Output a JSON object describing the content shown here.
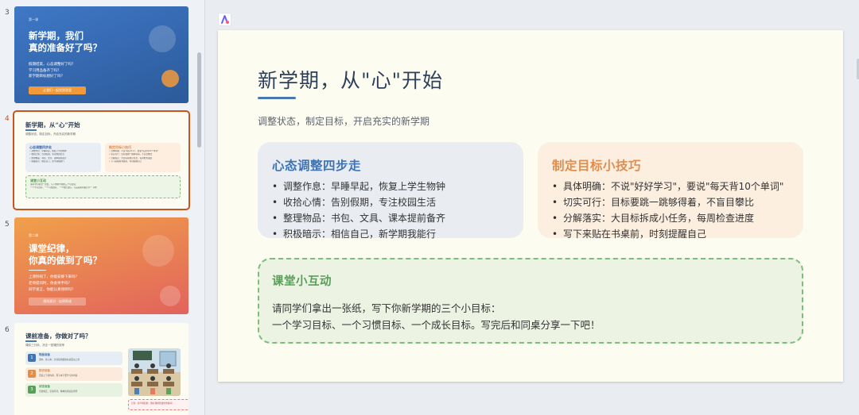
{
  "thumbnails": [
    {
      "number": "3",
      "tag": "第一课",
      "title_lines": [
        "新学期，我们",
        "真的准备好了吗？"
      ],
      "subtitle_lines": [
        "假期结束，心态调整好了吗？",
        "学习用品备齐了吗？",
        "新学期目标想好了吗？"
      ],
      "button": "让我们一起找到答案"
    },
    {
      "number": "4",
      "title": "新学期，从“心”开始",
      "subtitle": "调整状态，制定目标，开启充实的新学期",
      "box1_title": "心态调整四步走",
      "box1_lines": [
        "• 调整作息：早睡早起，恢复上学生物钟",
        "• 收拾心情：告别假期，专注校园生活",
        "• 整理物品：书包、文具、课本提前备齐",
        "• 积极暗示：相信自己，新学期我能行"
      ],
      "box2_title": "制定目标小技巧",
      "box2_lines": [
        "• 具体明确：不说\"好好学习\"，要说\"每天背10个单词\"",
        "• 切实可行：目标要跳一跳够得着，不盲目攀比",
        "• 分解落实：大目标拆成小任务，每周检查进度",
        "• 写下来贴在书桌前，时刻提醒自己"
      ],
      "box3_title": "课堂小互动",
      "box3_lines": [
        "请同学们拿出一张纸，写下你新学期的三个小目标：",
        "一个学习目标、一个习惯目标、一个成长目标。写完后和同桌分享一下吧！"
      ]
    },
    {
      "number": "5",
      "tag": "第二课",
      "title_lines": [
        "课堂纪律，",
        "你真的做到了吗？"
      ],
      "subtitle_lines": [
        "上课铃响了，你能安静下来吗？",
        "老师提问时，你会举手吗？",
        "同学发言，你能认真倾听吗？"
      ],
      "button": "规则意识 · 自律养成"
    },
    {
      "number": "6",
      "title": "课前准备，你做对了吗？",
      "subtitle": "课前三分钟，决定一堂课的效率",
      "rows": [
        {
          "num": "1",
          "title": "物品准备",
          "desc": "课本、练习本、文具提前摆放在桌面左上角"
        },
        {
          "num": "2",
          "title": "知识准备",
          "desc": "回顾上节课内容，预习本节要学习的内容"
        },
        {
          "num": "3",
          "title": "状态准备",
          "desc": "坐姿端正，安静等待，精神饱满迎接老师"
        }
      ],
      "note": "记住：铃声响起前，做好课前准备的你最棒！"
    }
  ],
  "slide": {
    "title": "新学期，从\"心\"开始",
    "subtitle": "调整状态，制定目标，开启充实的新学期",
    "left_card": {
      "heading": "心态调整四步走",
      "items": [
        "调整作息：早睡早起，恢复上学生物钟",
        "收拾心情：告别假期，专注校园生活",
        "整理物品：书包、文具、课本提前备齐",
        "积极暗示：相信自己，新学期我能行"
      ]
    },
    "right_card": {
      "heading": "制定目标小技巧",
      "items": [
        "具体明确：不说\"好好学习\"，要说\"每天背10个单词\"",
        "切实可行：目标要跳一跳够得着，不盲目攀比",
        "分解落实：大目标拆成小任务，每周检查进度",
        "写下来贴在书桌前，时刻提醒自己"
      ]
    },
    "interaction": {
      "heading": "课堂小互动",
      "line1": "请同学们拿出一张纸，写下你新学期的三个小目标：",
      "line2": "一个学习目标、一个习惯目标、一个成长目标。写完后和同桌分享一下吧！"
    }
  },
  "colors": {
    "accent_blue": "#3e73b5",
    "accent_orange": "#e08d4e",
    "accent_green": "#58a05a",
    "active_border": "#c9541e",
    "slide_bg": "#fdfcf1"
  },
  "icons": {
    "app_logo": "app-logo-icon",
    "bullet": "bullet-dot-icon"
  }
}
